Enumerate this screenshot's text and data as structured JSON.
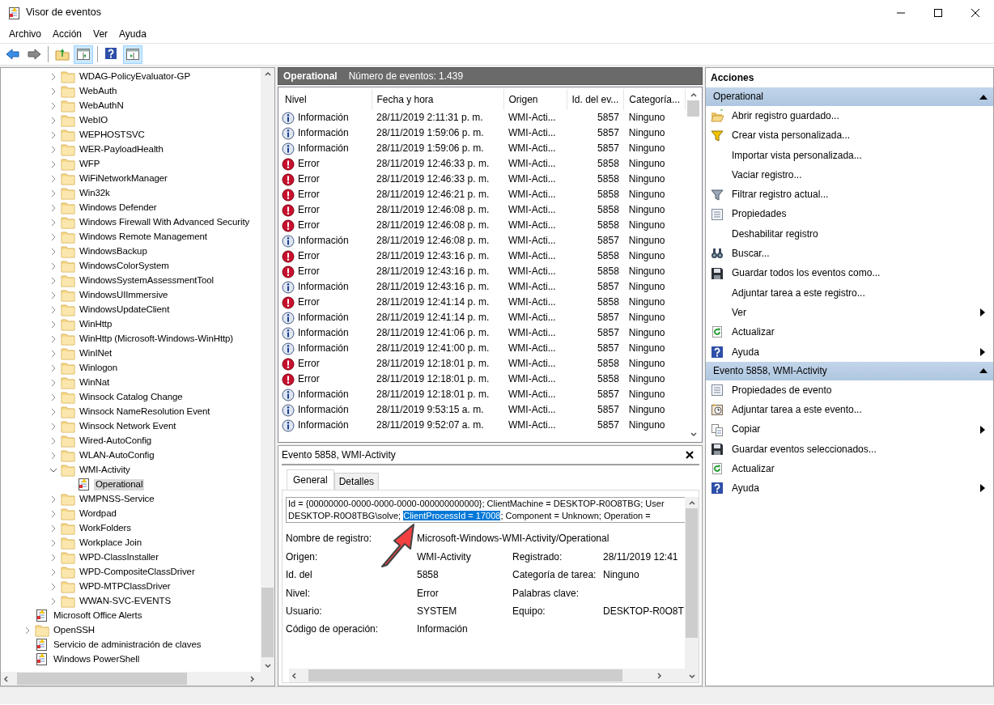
{
  "window": {
    "title": "Visor de eventos"
  },
  "menu": [
    "Archivo",
    "Acción",
    "Ver",
    "Ayuda"
  ],
  "toolbar": [
    {
      "kind": "back",
      "on": false
    },
    {
      "kind": "forward",
      "on": false
    },
    {
      "kind": "separator"
    },
    {
      "kind": "up-folder",
      "on": false
    },
    {
      "kind": "console-tree",
      "on": true
    },
    {
      "kind": "separator"
    },
    {
      "kind": "help",
      "on": false
    },
    {
      "kind": "action-pane",
      "on": true
    }
  ],
  "tree": {
    "deep_items": [
      {
        "label": "WDAG-PolicyEvaluator-GP",
        "kind": "folder",
        "expanded": false,
        "selected": false
      },
      {
        "label": "WebAuth",
        "kind": "folder",
        "expanded": false,
        "selected": false
      },
      {
        "label": "WebAuthN",
        "kind": "folder",
        "expanded": false,
        "selected": false
      },
      {
        "label": "WebIO",
        "kind": "folder",
        "expanded": false,
        "selected": false
      },
      {
        "label": "WEPHOSTSVC",
        "kind": "folder",
        "expanded": false,
        "selected": false
      },
      {
        "label": "WER-PayloadHealth",
        "kind": "folder",
        "expanded": false,
        "selected": false
      },
      {
        "label": "WFP",
        "kind": "folder",
        "expanded": false,
        "selected": false
      },
      {
        "label": "WiFiNetworkManager",
        "kind": "folder",
        "expanded": false,
        "selected": false
      },
      {
        "label": "Win32k",
        "kind": "folder",
        "expanded": false,
        "selected": false
      },
      {
        "label": "Windows Defender",
        "kind": "folder",
        "expanded": false,
        "selected": false
      },
      {
        "label": "Windows Firewall With Advanced Security",
        "kind": "folder",
        "expanded": false,
        "selected": false
      },
      {
        "label": "Windows Remote Management",
        "kind": "folder",
        "expanded": false,
        "selected": false
      },
      {
        "label": "WindowsBackup",
        "kind": "folder",
        "expanded": false,
        "selected": false
      },
      {
        "label": "WindowsColorSystem",
        "kind": "folder",
        "expanded": false,
        "selected": false
      },
      {
        "label": "WindowsSystemAssessmentTool",
        "kind": "folder",
        "expanded": false,
        "selected": false
      },
      {
        "label": "WindowsUIImmersive",
        "kind": "folder",
        "expanded": false,
        "selected": false
      },
      {
        "label": "WindowsUpdateClient",
        "kind": "folder",
        "expanded": false,
        "selected": false
      },
      {
        "label": "WinHttp",
        "kind": "folder",
        "expanded": false,
        "selected": false
      },
      {
        "label": "WinHttp (Microsoft-Windows-WinHttp)",
        "kind": "folder",
        "expanded": false,
        "selected": false
      },
      {
        "label": "WinINet",
        "kind": "folder",
        "expanded": false,
        "selected": false
      },
      {
        "label": "Winlogon",
        "kind": "folder",
        "expanded": false,
        "selected": false
      },
      {
        "label": "WinNat",
        "kind": "folder",
        "expanded": false,
        "selected": false
      },
      {
        "label": "Winsock Catalog Change",
        "kind": "folder",
        "expanded": false,
        "selected": false
      },
      {
        "label": "Winsock NameResolution Event",
        "kind": "folder",
        "expanded": false,
        "selected": false
      },
      {
        "label": "Winsock Network Event",
        "kind": "folder",
        "expanded": false,
        "selected": false
      },
      {
        "label": "Wired-AutoConfig",
        "kind": "folder",
        "expanded": false,
        "selected": false
      },
      {
        "label": "WLAN-AutoConfig",
        "kind": "folder",
        "expanded": false,
        "selected": false
      },
      {
        "label": "WMI-Activity",
        "kind": "folder",
        "expanded": true,
        "selected": false,
        "children": [
          {
            "label": "Operational",
            "kind": "log",
            "selected": true
          }
        ]
      },
      {
        "label": "WMPNSS-Service",
        "kind": "folder",
        "expanded": false,
        "selected": false
      },
      {
        "label": "Wordpad",
        "kind": "folder",
        "expanded": false,
        "selected": false
      },
      {
        "label": "WorkFolders",
        "kind": "folder",
        "expanded": false,
        "selected": false
      },
      {
        "label": "Workplace Join",
        "kind": "folder",
        "expanded": false,
        "selected": false
      },
      {
        "label": "WPD-ClassInstaller",
        "kind": "folder",
        "expanded": false,
        "selected": false
      },
      {
        "label": "WPD-CompositeClassDriver",
        "kind": "folder",
        "expanded": false,
        "selected": false
      },
      {
        "label": "WPD-MTPClassDriver",
        "kind": "folder",
        "expanded": false,
        "selected": false
      },
      {
        "label": "WWAN-SVC-EVENTS",
        "kind": "folder",
        "expanded": false,
        "selected": false
      }
    ],
    "items": [
      {
        "label": "Microsoft Office Alerts",
        "kind": "log",
        "selected": false
      },
      {
        "label": "OpenSSH",
        "kind": "folder",
        "expanded": false,
        "selected": false
      },
      {
        "label": "Servicio de administración de claves",
        "kind": "log",
        "selected": false
      },
      {
        "label": "Windows PowerShell",
        "kind": "log",
        "selected": false
      }
    ]
  },
  "events_header": {
    "title": "Operational",
    "count": "Número de eventos: 1.439"
  },
  "events": {
    "columns": [
      "Nivel",
      "Fecha y hora",
      "Origen",
      "Id. del ev...",
      "Categoría..."
    ],
    "rows": [
      {
        "kind": "info",
        "nivel": "Información",
        "date": "28/11/2019 2:11:31 p. m.",
        "source": "WMI-Acti...",
        "id": "5857",
        "category": "Ninguno"
      },
      {
        "kind": "info",
        "nivel": "Información",
        "date": "28/11/2019 1:59:06 p. m.",
        "source": "WMI-Acti...",
        "id": "5857",
        "category": "Ninguno"
      },
      {
        "kind": "info",
        "nivel": "Información",
        "date": "28/11/2019 1:59:06 p. m.",
        "source": "WMI-Acti...",
        "id": "5857",
        "category": "Ninguno"
      },
      {
        "kind": "error",
        "nivel": "Error",
        "date": "28/11/2019 12:46:33 p. m.",
        "source": "WMI-Acti...",
        "id": "5858",
        "category": "Ninguno"
      },
      {
        "kind": "error",
        "nivel": "Error",
        "date": "28/11/2019 12:46:33 p. m.",
        "source": "WMI-Acti...",
        "id": "5858",
        "category": "Ninguno"
      },
      {
        "kind": "error",
        "nivel": "Error",
        "date": "28/11/2019 12:46:21 p. m.",
        "source": "WMI-Acti...",
        "id": "5858",
        "category": "Ninguno"
      },
      {
        "kind": "error",
        "nivel": "Error",
        "date": "28/11/2019 12:46:08 p. m.",
        "source": "WMI-Acti...",
        "id": "5858",
        "category": "Ninguno"
      },
      {
        "kind": "error",
        "nivel": "Error",
        "date": "28/11/2019 12:46:08 p. m.",
        "source": "WMI-Acti...",
        "id": "5858",
        "category": "Ninguno"
      },
      {
        "kind": "info",
        "nivel": "Información",
        "date": "28/11/2019 12:46:08 p. m.",
        "source": "WMI-Acti...",
        "id": "5857",
        "category": "Ninguno"
      },
      {
        "kind": "error",
        "nivel": "Error",
        "date": "28/11/2019 12:43:16 p. m.",
        "source": "WMI-Acti...",
        "id": "5858",
        "category": "Ninguno"
      },
      {
        "kind": "error",
        "nivel": "Error",
        "date": "28/11/2019 12:43:16 p. m.",
        "source": "WMI-Acti...",
        "id": "5858",
        "category": "Ninguno"
      },
      {
        "kind": "info",
        "nivel": "Información",
        "date": "28/11/2019 12:43:16 p. m.",
        "source": "WMI-Acti...",
        "id": "5857",
        "category": "Ninguno"
      },
      {
        "kind": "error",
        "nivel": "Error",
        "date": "28/11/2019 12:41:14 p. m.",
        "source": "WMI-Acti...",
        "id": "5858",
        "category": "Ninguno"
      },
      {
        "kind": "info",
        "nivel": "Información",
        "date": "28/11/2019 12:41:14 p. m.",
        "source": "WMI-Acti...",
        "id": "5857",
        "category": "Ninguno"
      },
      {
        "kind": "info",
        "nivel": "Información",
        "date": "28/11/2019 12:41:06 p. m.",
        "source": "WMI-Acti...",
        "id": "5857",
        "category": "Ninguno"
      },
      {
        "kind": "info",
        "nivel": "Información",
        "date": "28/11/2019 12:41:00 p. m.",
        "source": "WMI-Acti...",
        "id": "5857",
        "category": "Ninguno"
      },
      {
        "kind": "error",
        "nivel": "Error",
        "date": "28/11/2019 12:18:01 p. m.",
        "source": "WMI-Acti...",
        "id": "5858",
        "category": "Ninguno"
      },
      {
        "kind": "error",
        "nivel": "Error",
        "date": "28/11/2019 12:18:01 p. m.",
        "source": "WMI-Acti...",
        "id": "5858",
        "category": "Ninguno"
      },
      {
        "kind": "info",
        "nivel": "Información",
        "date": "28/11/2019 12:18:01 p. m.",
        "source": "WMI-Acti...",
        "id": "5857",
        "category": "Ninguno"
      },
      {
        "kind": "info",
        "nivel": "Información",
        "date": "28/11/2019 9:53:15 a. m.",
        "source": "WMI-Acti...",
        "id": "5857",
        "category": "Ninguno"
      },
      {
        "kind": "info",
        "nivel": "Información",
        "date": "28/11/2019 9:52:07 a. m.",
        "source": "WMI-Acti...",
        "id": "5857",
        "category": "Ninguno"
      }
    ]
  },
  "detail": {
    "title": "Evento 5858, WMI-Activity",
    "tabs": [
      {
        "label": "General",
        "selected": true
      },
      {
        "label": "Detalles",
        "selected": false
      }
    ],
    "description_lines": [
      {
        "text": "Id = {00000000-0000-0000-0000-000000000000}; ClientMachine = DESKTOP-R0O8TBG; User"
      },
      {
        "text": "DESKTOP-R0O8TBG\\solve; ",
        "selection": "ClientProcessId = 17008",
        "rest": "; Component = Unknown; Operation ="
      }
    ],
    "log_name": {
      "label": "Nombre de registro:",
      "value": "Microsoft-Windows-WMI-Activity/Operational"
    },
    "fields": [
      {
        "label": "Origen:",
        "value": "WMI-Activity",
        "label2": "Registrado:",
        "value2": "28/11/2019 12:41"
      },
      {
        "label": "Id. del",
        "value": "5858",
        "label2": "Categoría de tarea:",
        "value2": "Ninguno"
      },
      {
        "label": "Nivel:",
        "value": "Error",
        "label2": "Palabras clave:"
      },
      {
        "label": "Usuario:",
        "value": "SYSTEM",
        "label2": "Equipo:",
        "value2": "DESKTOP-R0O8T"
      },
      {
        "label": "Código de operación:",
        "value": "Información"
      }
    ]
  },
  "actions": {
    "title": "Acciones",
    "sections": [
      {
        "title": "Operational",
        "expanded": true,
        "items": [
          {
            "label": "Abrir registro guardado...",
            "kind": "folder-open",
            "submenu": false
          },
          {
            "label": "Crear vista personalizada...",
            "kind": "filter-new",
            "submenu": false
          },
          {
            "label": "Importar vista personalizada...",
            "kind": "plain",
            "submenu": false
          },
          {
            "label": "Vaciar registro...",
            "kind": "plain",
            "submenu": false
          },
          {
            "label": "Filtrar registro actual...",
            "kind": "filter",
            "submenu": false
          },
          {
            "label": "Propiedades",
            "kind": "properties",
            "submenu": false
          },
          {
            "label": "Deshabilitar registro",
            "kind": "plain",
            "submenu": false
          },
          {
            "label": "Buscar...",
            "kind": "binoculars",
            "submenu": false
          },
          {
            "label": "Guardar todos los eventos como...",
            "kind": "save",
            "submenu": false
          },
          {
            "label": "Adjuntar tarea a este registro...",
            "kind": "plain",
            "submenu": false
          },
          {
            "label": "Ver",
            "kind": "plain",
            "submenu": true
          },
          {
            "label": "Actualizar",
            "kind": "refresh",
            "submenu": false
          },
          {
            "label": "Ayuda",
            "kind": "help",
            "submenu": true
          }
        ]
      },
      {
        "title": "Evento 5858, WMI-Activity",
        "expanded": true,
        "items": [
          {
            "label": "Propiedades de evento",
            "kind": "properties",
            "submenu": false
          },
          {
            "label": "Adjuntar tarea a este evento...",
            "kind": "task",
            "submenu": false
          },
          {
            "label": "Copiar",
            "kind": "copy",
            "submenu": true
          },
          {
            "label": "Guardar eventos seleccionados...",
            "kind": "save",
            "submenu": false
          },
          {
            "label": "Actualizar",
            "kind": "refresh",
            "submenu": false
          },
          {
            "label": "Ayuda",
            "kind": "help",
            "submenu": true
          }
        ]
      }
    ]
  }
}
